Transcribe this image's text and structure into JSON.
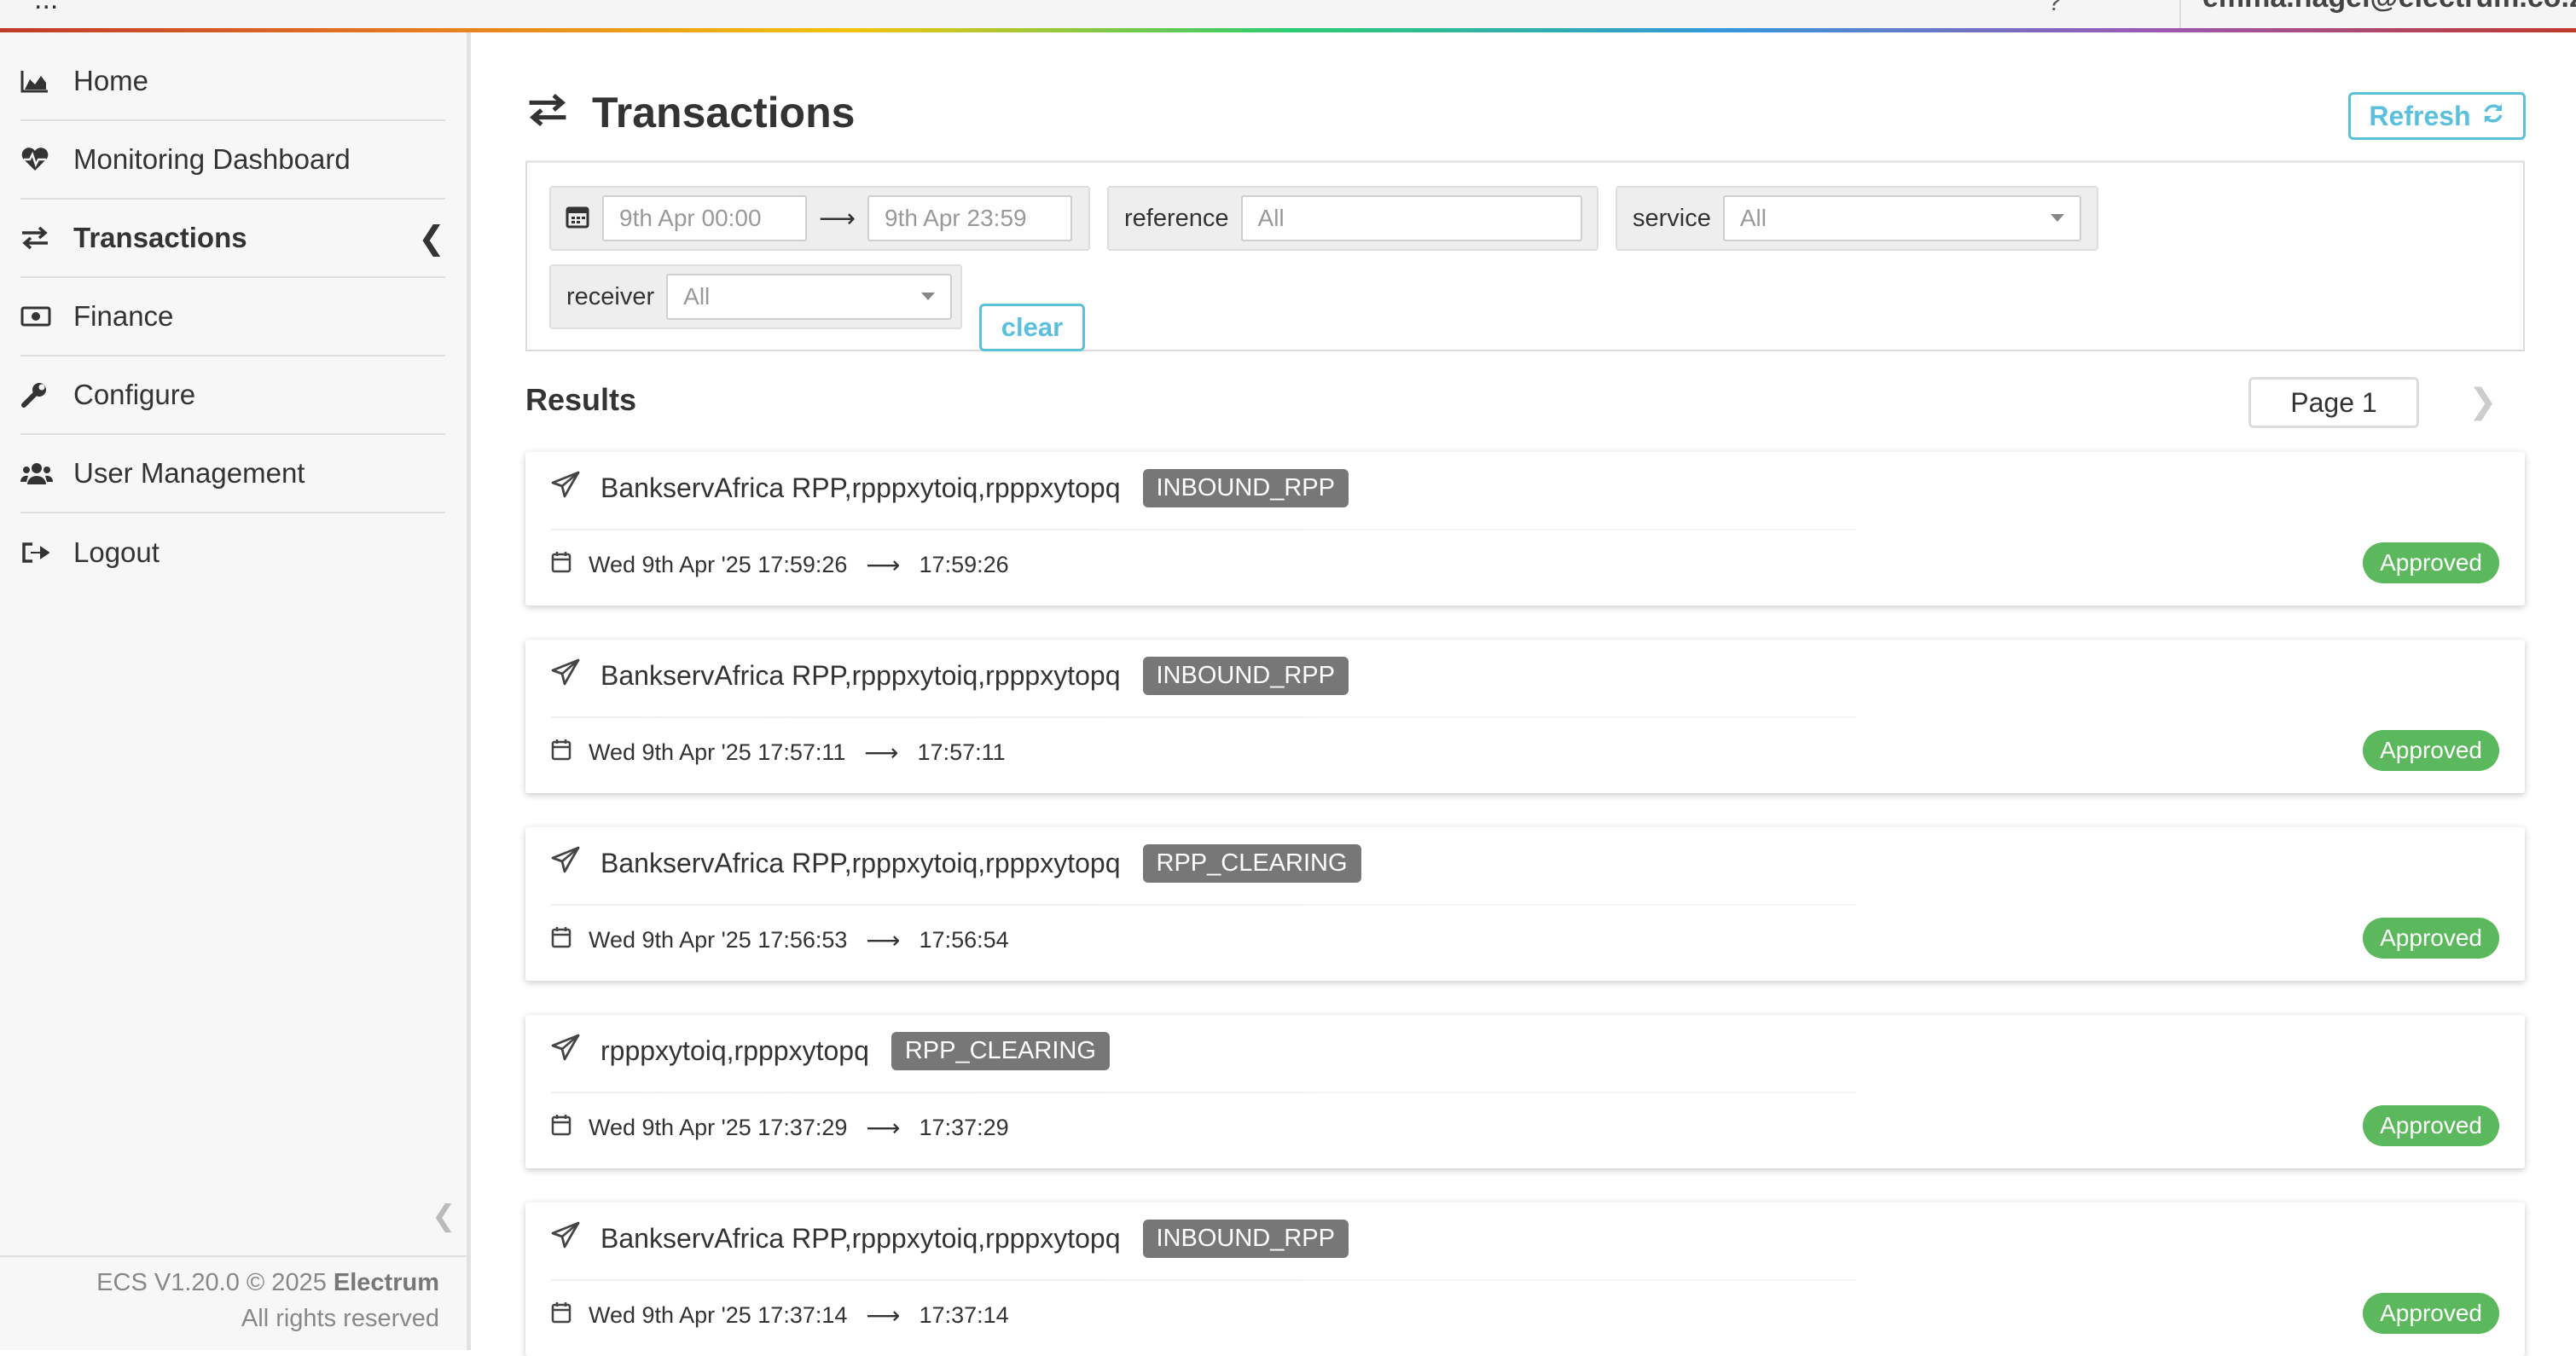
{
  "topbar": {
    "left_text": "...",
    "user_email": "emma.nagel@electrum.co.za"
  },
  "sidebar": {
    "items": [
      {
        "label": "Home",
        "icon": "area-chart-icon"
      },
      {
        "label": "Monitoring Dashboard",
        "icon": "heartbeat-icon"
      },
      {
        "label": "Transactions",
        "icon": "exchange-icon",
        "active": true
      },
      {
        "label": "Finance",
        "icon": "money-icon"
      },
      {
        "label": "Configure",
        "icon": "wrench-icon"
      },
      {
        "label": "User Management",
        "icon": "users-icon"
      },
      {
        "label": "Logout",
        "icon": "sign-out-icon"
      }
    ],
    "footer_version": "ECS V1.20.0 © 2025",
    "footer_brand": "Electrum",
    "footer_rights": "All rights reserved"
  },
  "page": {
    "title": "Transactions",
    "refresh_label": "Refresh"
  },
  "filters": {
    "date_from": "9th Apr 00:00",
    "date_to": "9th Apr 23:59",
    "reference_label": "reference",
    "reference_placeholder": "All",
    "service_label": "service",
    "service_value": "All",
    "receiver_label": "receiver",
    "receiver_value": "All",
    "clear_label": "clear"
  },
  "results": {
    "heading": "Results",
    "page_label": "Page 1",
    "transactions": [
      {
        "name": "BankservAfrica RPP,rpppxytoiq,rpppxytopq",
        "type": "INBOUND_RPP",
        "start": "Wed 9th Apr '25 17:59:26",
        "end": "17:59:26",
        "status": "Approved"
      },
      {
        "name": "BankservAfrica RPP,rpppxytoiq,rpppxytopq",
        "type": "INBOUND_RPP",
        "start": "Wed 9th Apr '25 17:57:11",
        "end": "17:57:11",
        "status": "Approved"
      },
      {
        "name": "BankservAfrica RPP,rpppxytoiq,rpppxytopq",
        "type": "RPP_CLEARING",
        "start": "Wed 9th Apr '25 17:56:53",
        "end": "17:56:54",
        "status": "Approved"
      },
      {
        "name": "rpppxytoiq,rpppxytopq",
        "type": "RPP_CLEARING",
        "start": "Wed 9th Apr '25 17:37:29",
        "end": "17:37:29",
        "status": "Approved"
      },
      {
        "name": "BankservAfrica RPP,rpppxytoiq,rpppxytopq",
        "type": "INBOUND_RPP",
        "start": "Wed 9th Apr '25 17:37:14",
        "end": "17:37:14",
        "status": "Approved"
      }
    ]
  },
  "colors": {
    "accent": "#5bc0de",
    "approved": "#5cb85c",
    "badge": "#777777"
  }
}
